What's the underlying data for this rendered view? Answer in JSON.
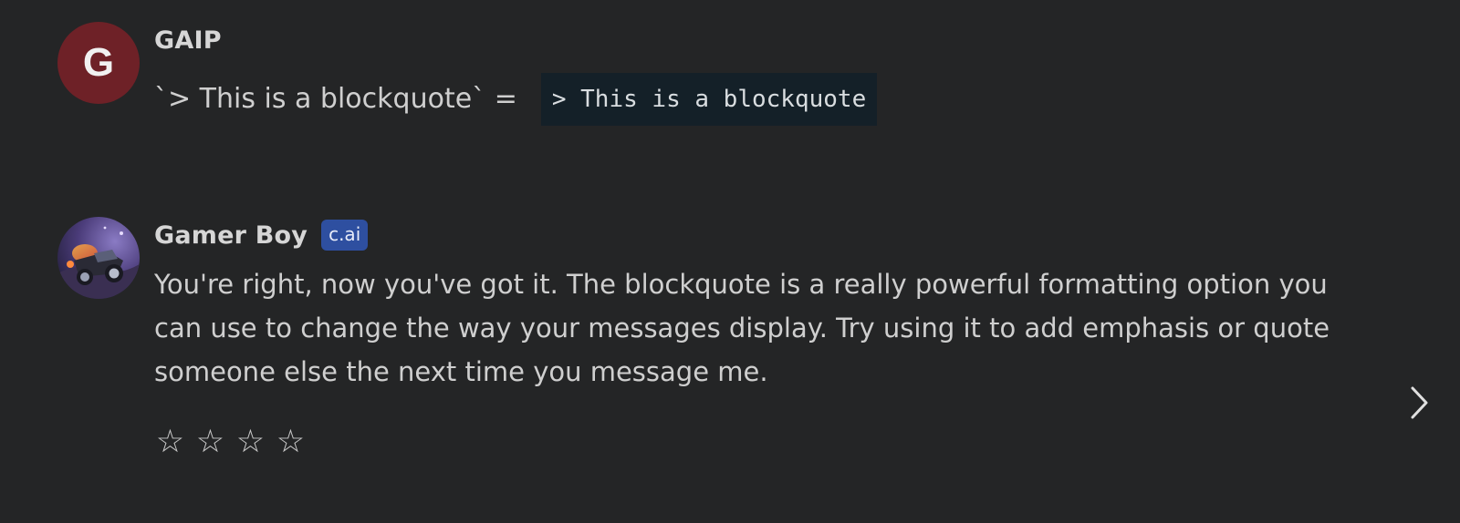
{
  "messages": [
    {
      "author": "GAIP",
      "avatar_letter": "G",
      "avatar_color": "#6e2127",
      "text": "`> This is a blockquote` =",
      "code": "> This is a blockquote"
    },
    {
      "author": "Gamer Boy",
      "badge": "c.ai",
      "avatar_icon": "rocket-car-avatar",
      "text": "You're right, now you've got it. The blockquote is a really powerful formatting option you can use to change the way your messages display. Try using it to add emphasis or quote someone else the next time you message me."
    }
  ],
  "rating": {
    "stars": [
      "☆",
      "☆",
      "☆",
      "☆"
    ],
    "value": 0,
    "max": 4
  },
  "navigation": {
    "next_icon": "chevron-right-icon"
  },
  "colors": {
    "background": "#242526",
    "badge": "#2e4fa0",
    "code_background": "#142028"
  }
}
